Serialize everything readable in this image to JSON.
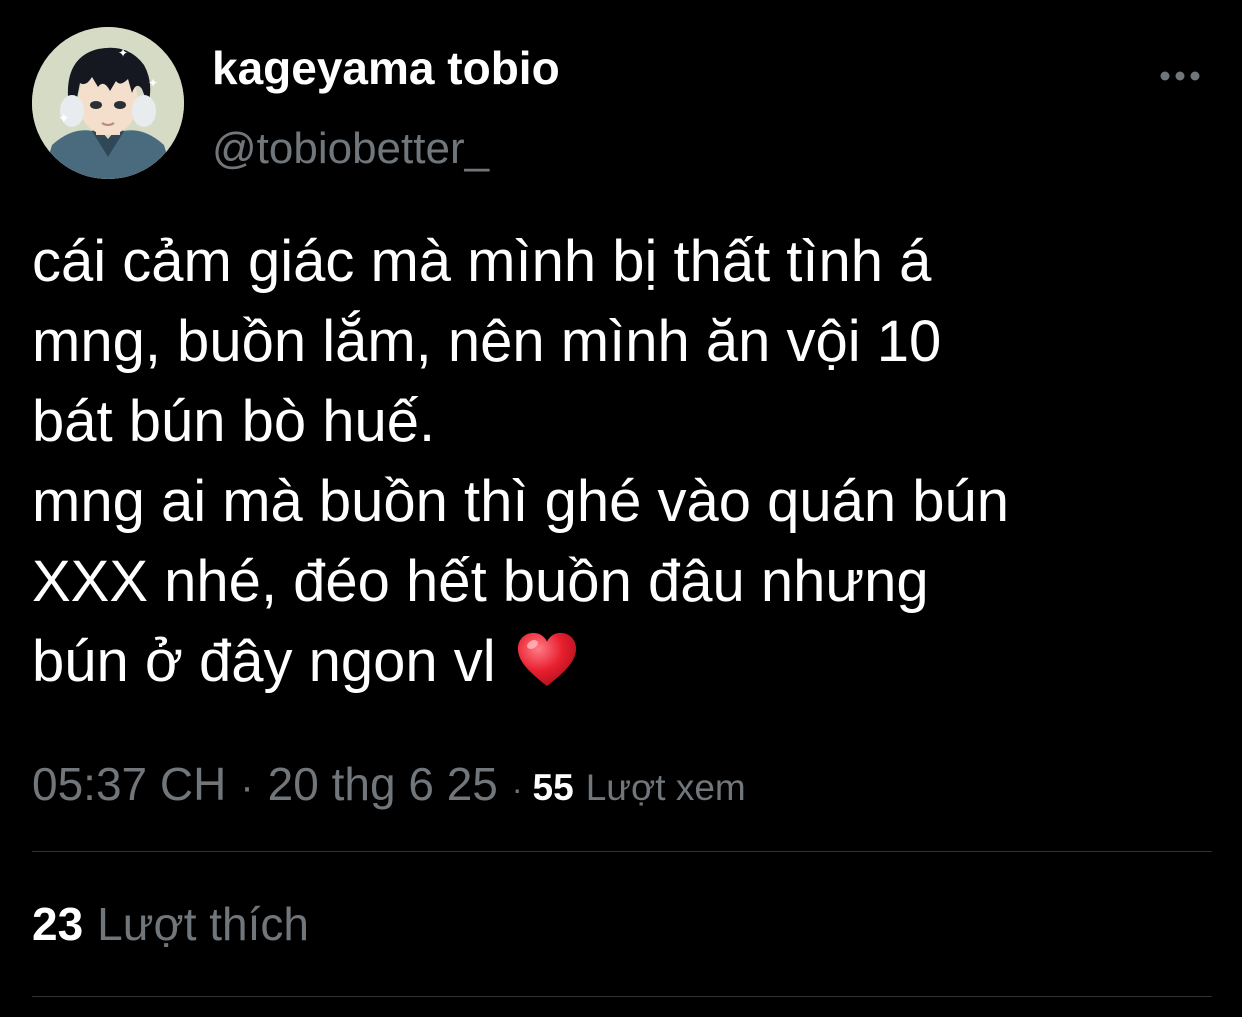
{
  "author": {
    "display_name": "kageyama tobio",
    "handle": "@tobiobetter_",
    "avatar_icon": "anime-character-avatar"
  },
  "tweet": {
    "lines": [
      "cái cảm giác mà mình bị thất tình á",
      "mng, buồn lắm, nên mình ăn vội 10",
      "bát bún bò huế.",
      "mng ai mà buồn thì ghé vào quán bún",
      "XXX nhé, đéo hết buồn đâu nhưng",
      "bún ở đây ngon vl"
    ],
    "trailing_emoji": "red-heart-emoji"
  },
  "meta": {
    "time": "05:37 CH",
    "separator": "·",
    "date": "20 thg 6 25",
    "views_count": "55",
    "views_label": "Lượt xem"
  },
  "engagement": {
    "likes_count": "23",
    "likes_label": "Lượt thích"
  },
  "colors": {
    "background": "#000000",
    "primary_text": "#ffffff",
    "secondary_text": "#71767b",
    "divider": "#2f3336",
    "heart": "#e0245e"
  },
  "icons": {
    "more": "more-horizontal-icon"
  }
}
